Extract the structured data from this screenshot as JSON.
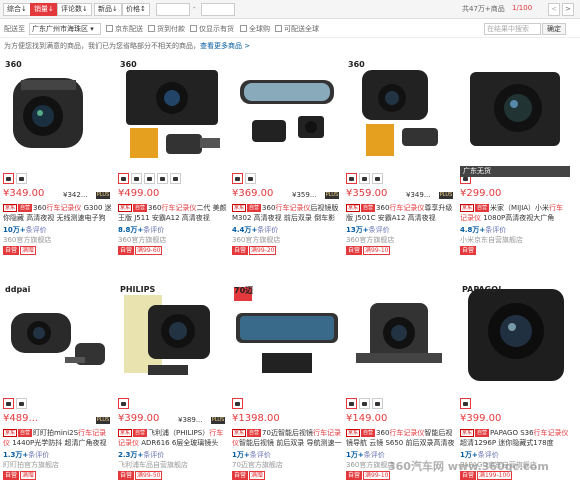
{
  "sort": {
    "items": [
      "综合",
      "销量",
      "评论数",
      "新品",
      "价格"
    ],
    "arrows": [
      "↓",
      "↓",
      "↓",
      "↓",
      "↕"
    ],
    "active": 1,
    "price_sep": "-",
    "total": "共47万+商品",
    "page": "1/100",
    "prev": "<",
    "next": ">"
  },
  "filter": {
    "ship_label": "配送至",
    "location": "广东广州市海珠区",
    "location_arrow": "▾",
    "options": [
      "京东配送",
      "货到付款",
      "仅显示有货",
      "全球购",
      "可配送全球"
    ],
    "search_placeholder": "在结果中搜索",
    "ok": "确定"
  },
  "tip": {
    "text": "为方便您找到满意的商品，我们已为您省略部分不相关的商品，",
    "link": "查看更多商品 >"
  },
  "plus": "PLUS",
  "products": [
    {
      "brand": "360",
      "price": "¥349.00",
      "price2": "¥342...",
      "plus": true,
      "tags": [
        "京东",
        "自营"
      ],
      "title_pre": "360",
      "title_hl": "行车记录仪",
      "title_post": " G300 迷你隐藏 高清夜视 无线测速电子狗",
      "cmt_num": "10万+",
      "cmt_txt": "条评价",
      "shop": "360官方旗舰店",
      "promos": [
        "自营",
        "满赠"
      ],
      "badge": ""
    },
    {
      "brand": "360",
      "price": "¥499.00",
      "price2": "",
      "plus": false,
      "tags": [
        "京东",
        "自营"
      ],
      "title_pre": "360",
      "title_hl": "行车记录仪",
      "title_post": "二代 美颜王版 J511 安霸A12 高清夜视",
      "cmt_num": "8.8万+",
      "cmt_txt": "条评价",
      "shop": "360官方旗舰店",
      "promos": [
        "自营",
        "满99-60"
      ],
      "badge": ""
    },
    {
      "brand": "",
      "price": "¥369.00",
      "price2": "¥359...",
      "plus": true,
      "tags": [
        "京东",
        "自营"
      ],
      "title_pre": "360",
      "title_hl": "行车记录仪",
      "title_post": "后视镜版 M302 高清夜视 前后双录 倒车影像",
      "cmt_num": "4.4万+",
      "cmt_txt": "条评价",
      "shop": "360官方旗舰店",
      "promos": [
        "自营",
        "满99-20"
      ],
      "badge": ""
    },
    {
      "brand": "360",
      "price": "¥359.00",
      "price2": "¥349...",
      "plus": true,
      "tags": [
        "京东",
        "自营"
      ],
      "title_pre": "360",
      "title_hl": "行车记录仪",
      "title_post": "尊享升级版 J501C 安霸A12 高清夜视",
      "cmt_num": "13万+",
      "cmt_txt": "条评价",
      "shop": "360官方旗舰店",
      "promos": [
        "自营",
        "满99-10"
      ],
      "badge": ""
    },
    {
      "brand": "",
      "price": "¥299.00",
      "price2": "",
      "plus": false,
      "tags": [
        "京东",
        "自营"
      ],
      "title_pre": "米家（MIJIA）小米",
      "title_hl": "行车记录仪",
      "title_post": " 1080P高清夜视大广角",
      "cmt_num": "4.8万+",
      "cmt_txt": "条评价",
      "shop": "小米京东自营旗舰店",
      "promos": [
        "自营"
      ],
      "badge": "广东无货"
    },
    {
      "brand": "ddpai",
      "price": "¥489...",
      "price2": "",
      "plus": true,
      "tags": [
        "京东",
        "自营"
      ],
      "title_pre": "盯盯拍mini2S",
      "title_hl": "行车记录仪",
      "title_post": " 1440P光学防抖 超清广角夜视",
      "cmt_num": "1.3万+",
      "cmt_txt": "条评价",
      "shop": "盯盯拍官方旗舰店",
      "promos": [
        "自营",
        "满赠"
      ],
      "badge": ""
    },
    {
      "brand": "PHILIPS",
      "price": "¥399.00",
      "price2": "¥389...",
      "plus": true,
      "tags": [
        "京东",
        "自营"
      ],
      "title_pre": "飞利浦（PHILIPS）",
      "title_hl": "行车记录仪",
      "title_post": " ADR616 6层全玻璃镜头",
      "cmt_num": "2.3万+",
      "cmt_txt": "条评价",
      "shop": "飞利浦车品自营旗舰店",
      "promos": [
        "自营",
        "满99-50"
      ],
      "badge": ""
    },
    {
      "brand": "70迈",
      "price": "¥1398.00",
      "price2": "",
      "plus": false,
      "tags": [
        "京东",
        "自营"
      ],
      "title_pre": "70迈智能后视镜",
      "title_hl": "行车记录仪",
      "title_post": "智能后视镜 前后双录 导航测速一体机",
      "cmt_num": "1万+",
      "cmt_txt": "条评价",
      "shop": "70迈官方旗舰店",
      "promos": [
        "自营",
        "满赠"
      ],
      "badge": ""
    },
    {
      "brand": "",
      "price": "¥149.00",
      "price2": "",
      "plus": false,
      "tags": [
        "京东",
        "自营"
      ],
      "title_pre": "360",
      "title_hl": "行车记录仪",
      "title_post": "智能后视镜导航 云镜 S650 前后双录高清夜视",
      "cmt_num": "1万+",
      "cmt_txt": "条评价",
      "shop": "360官方旗舰店",
      "promos": [
        "自营",
        "满99-10"
      ],
      "badge": ""
    },
    {
      "brand": "PAPAGO!",
      "price": "¥399.00",
      "price2": "",
      "plus": false,
      "tags": [
        "京东",
        "自营"
      ],
      "title_pre": "PAPAGO S36",
      "title_hl": "行车记录仪",
      "title_post": " 超清1296P 迷你隐藏式178度",
      "cmt_num": "1万+",
      "cmt_txt": "条评价",
      "shop": "PAPAGO京东自营旗舰店",
      "promos": [
        "自营",
        "满199-100"
      ],
      "badge": ""
    }
  ],
  "watermark": "360汽车网 www.360qc.com"
}
